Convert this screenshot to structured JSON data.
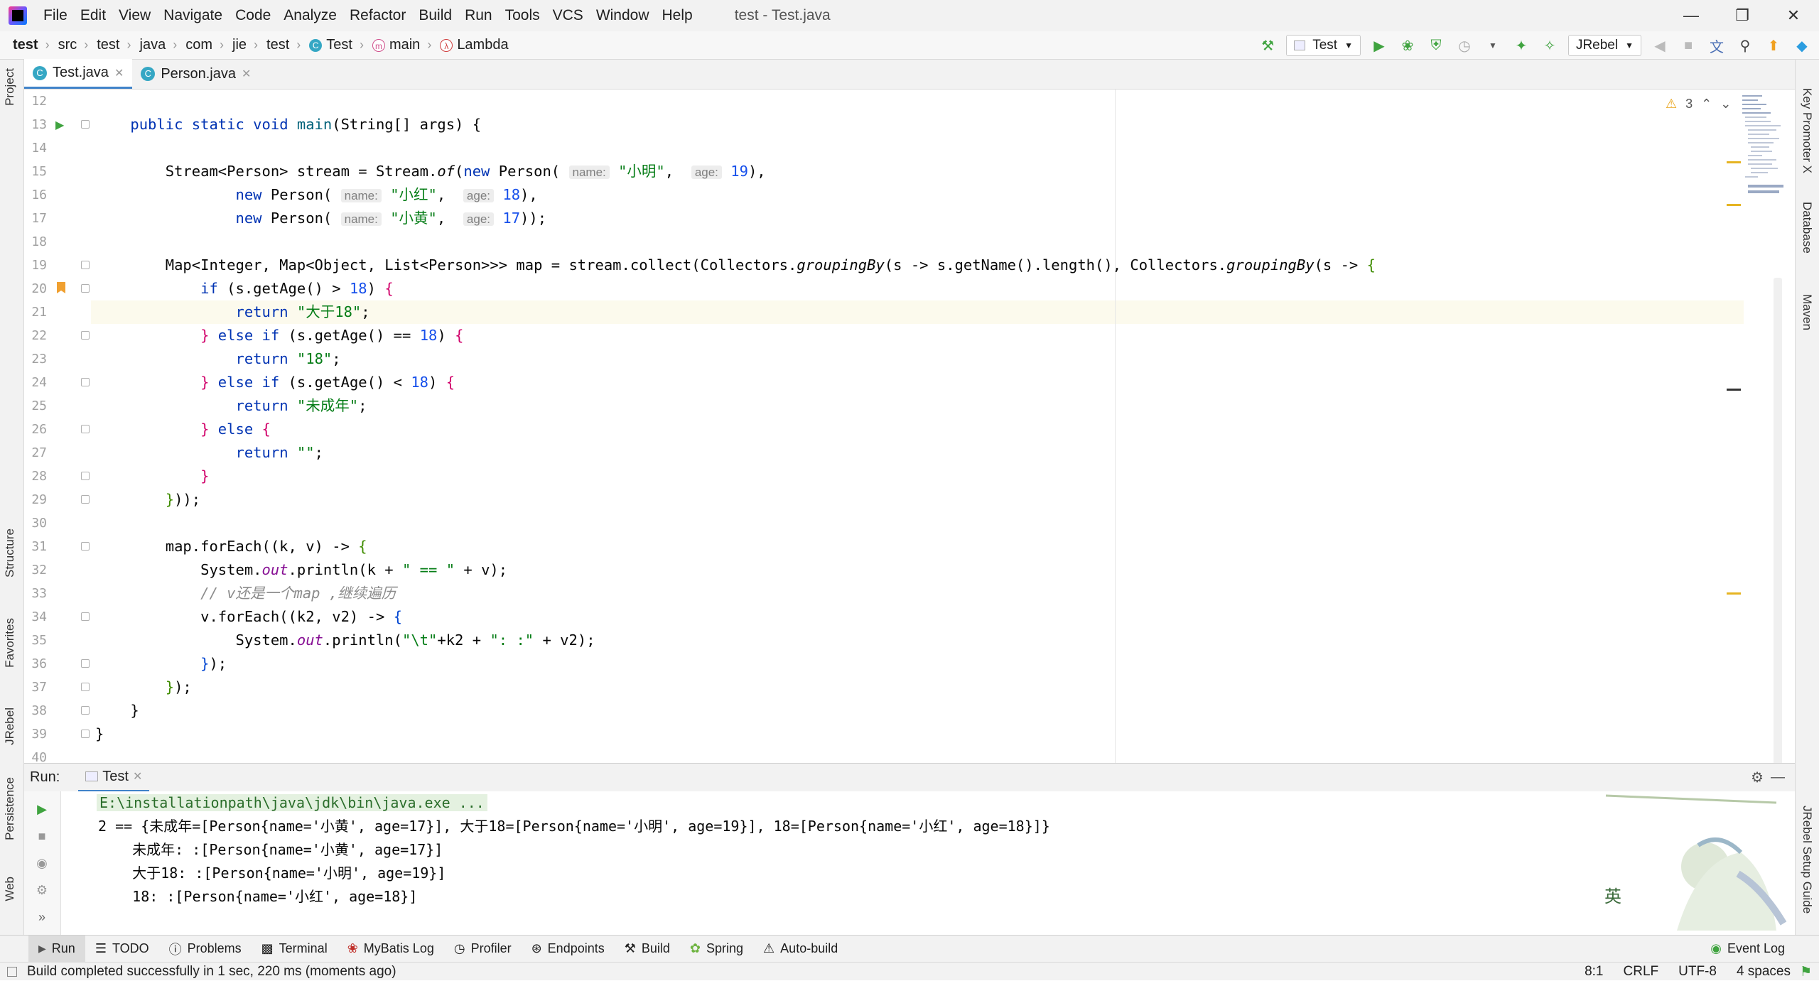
{
  "window": {
    "title": "test - Test.java",
    "menu": [
      "File",
      "Edit",
      "View",
      "Navigate",
      "Code",
      "Analyze",
      "Refactor",
      "Build",
      "Run",
      "Tools",
      "VCS",
      "Window",
      "Help"
    ]
  },
  "breadcrumbs": [
    "test",
    "src",
    "test",
    "java",
    "com",
    "jie",
    "test",
    "Test",
    "main",
    "Lambda"
  ],
  "toolbar": {
    "run_config": "Test",
    "jrebel_config": "JRebel"
  },
  "left_tools": [
    "Project",
    "Structure",
    "Favorites",
    "JRebel",
    "Persistence",
    "Web"
  ],
  "right_tools": [
    "Key Promoter X",
    "Database",
    "Maven",
    "JRebel Setup Guide"
  ],
  "editor_tabs": [
    {
      "label": "Test.java",
      "active": true
    },
    {
      "label": "Person.java",
      "active": false
    }
  ],
  "editor": {
    "warning_count": "3",
    "current_line": 21,
    "line_numbers": [
      "12",
      "13",
      "14",
      "15",
      "16",
      "17",
      "18",
      "19",
      "20",
      "21",
      "22",
      "23",
      "24",
      "25",
      "26",
      "27",
      "28",
      "29",
      "30",
      "31",
      "32",
      "33",
      "34",
      "35",
      "36",
      "37",
      "38",
      "39",
      "40"
    ],
    "hints": {
      "name": "name:",
      "age": "age:"
    },
    "strings": {
      "xiaoming": "\"小明\"",
      "xiaohong": "\"小红\"",
      "xiaohuang": "\"小黄\"",
      "gt18": "\"大于18\"",
      "eq18": "\"18\"",
      "minor": "\"未成年\"",
      "empty": "\"\"",
      "eqeq": "\" == \"",
      "tab": "\"\\t\"",
      "colon": "\": :\""
    },
    "numbers": {
      "n19": "19",
      "n18": "18",
      "n17": "17"
    },
    "comment": "// v还是一个map ,继续遍历"
  },
  "run_panel": {
    "label": "Run:",
    "tab": "Test",
    "console": [
      "E:\\installationpath\\java\\jdk\\bin\\java.exe ...",
      "2 == {未成年=[Person{name='小黄', age=17}], 大于18=[Person{name='小明', age=19}], 18=[Person{name='小红', age=18}]}",
      "    未成年: :[Person{name='小黄', age=17}]",
      "    大于18: :[Person{name='小明', age=19}]",
      "    18: :[Person{name='小红', age=18}]"
    ]
  },
  "bottom_tools": [
    "Run",
    "TODO",
    "Problems",
    "Terminal",
    "MyBatis Log",
    "Profiler",
    "Endpoints",
    "Build",
    "Spring",
    "Auto-build"
  ],
  "status": {
    "message": "Build completed successfully in 1 sec, 220 ms (moments ago)",
    "position": "8:1",
    "line_sep": "CRLF",
    "encoding": "UTF-8",
    "indent": "4 spaces",
    "event_log": "Event Log"
  },
  "colors": {
    "accent": "#4083c9",
    "keyword": "#0033b3",
    "string": "#067d17",
    "number": "#1750eb",
    "run_green": "#3fa33f"
  }
}
